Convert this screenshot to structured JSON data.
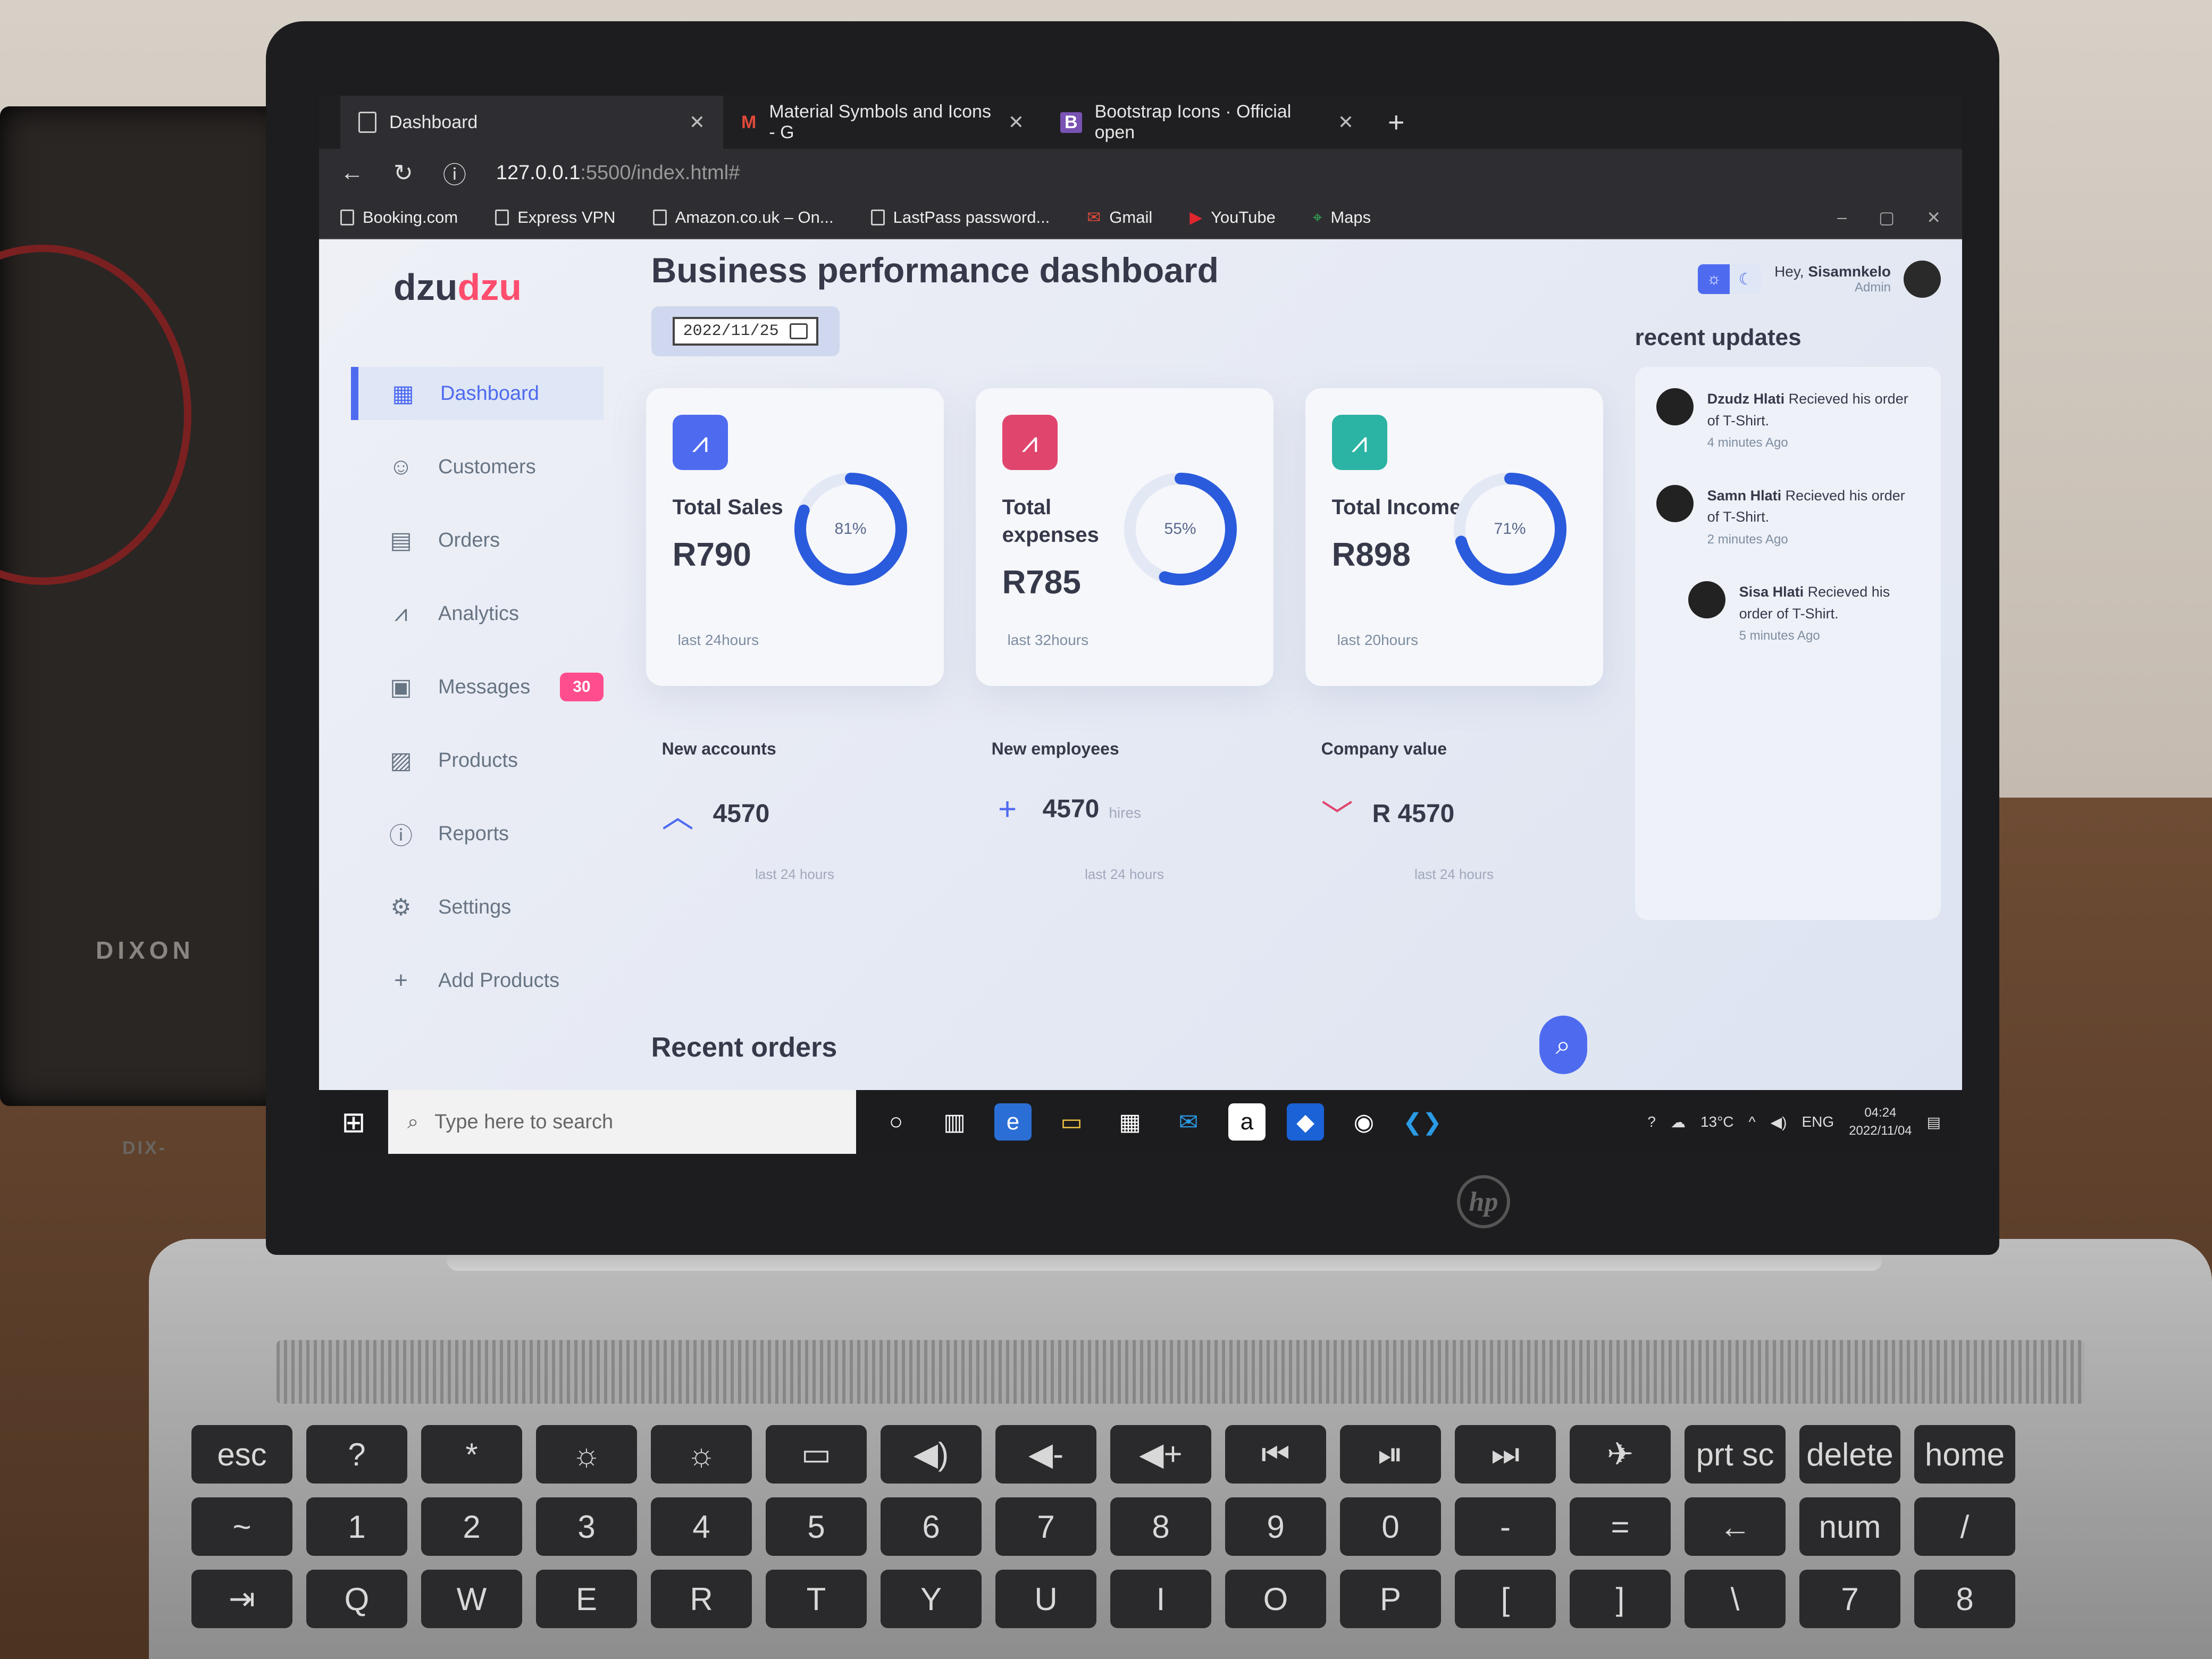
{
  "browser": {
    "tabs": [
      {
        "label": "Dashboard",
        "active": true
      },
      {
        "label": "Material Symbols and Icons - G",
        "active": false
      },
      {
        "label": "Bootstrap Icons · Official open",
        "active": false
      }
    ],
    "url_host": "127.0.0.1",
    "url_rest": ":5500/index.html#",
    "bookmarks": [
      "Booking.com",
      "Express VPN",
      "Amazon.co.uk – On...",
      "LastPass password...",
      "Gmail",
      "YouTube",
      "Maps"
    ]
  },
  "sidebar": {
    "brand_part1": "dzu",
    "brand_part2": "dzu",
    "items": [
      {
        "label": "Dashboard",
        "icon": "grid-icon",
        "active": true
      },
      {
        "label": "Customers",
        "icon": "person-icon"
      },
      {
        "label": "Orders",
        "icon": "receipt-icon"
      },
      {
        "label": "Analytics",
        "icon": "analytics-icon"
      },
      {
        "label": "Messages",
        "icon": "messages-icon",
        "badge": "30"
      },
      {
        "label": "Products",
        "icon": "clipboard-icon"
      },
      {
        "label": "Reports",
        "icon": "report-icon"
      },
      {
        "label": "Settings",
        "icon": "gear-icon"
      },
      {
        "label": "Add Products",
        "icon": "plus-icon"
      }
    ]
  },
  "main": {
    "title": "Business performance dashboard",
    "date": "2022/11/25",
    "cards": [
      {
        "title": "Total Sales",
        "value": "R790",
        "percent_label": "81%",
        "percent": 0.81,
        "sub": "last 24hours",
        "color": "#4e6bf0"
      },
      {
        "title": "Total expenses",
        "value": "R785",
        "percent_label": "55%",
        "percent": 0.55,
        "sub": "last 32hours",
        "color": "#e0456e"
      },
      {
        "title": "Total Income",
        "value": "R898",
        "percent_label": "71%",
        "percent": 0.71,
        "sub": "last 20hours",
        "color": "#2bb3a3"
      }
    ],
    "stats": [
      {
        "title": "New accounts",
        "value": "4570",
        "unit": "",
        "sub": "last 24 hours",
        "icon": "chevron-up-icon"
      },
      {
        "title": "New employees",
        "value": "4570",
        "unit": "hires",
        "sub": "last 24 hours",
        "icon": "plus-icon"
      },
      {
        "title": "Company value",
        "value": "R 4570",
        "unit": "",
        "sub": "last 24 hours",
        "icon": "chevron-down-icon"
      }
    ],
    "recent_orders": "Recent orders"
  },
  "right": {
    "greeting_prefix": "Hey,",
    "user": "Sisamnkelo",
    "role": "Admin",
    "recent_updates_title": "recent updates",
    "updates": [
      {
        "name": "Dzudz Hlati",
        "text": "Recieved his order of T-Shirt.",
        "time": "4 minutes Ago"
      },
      {
        "name": "Samn Hlati",
        "text": "Recieved his order of T-Shirt.",
        "time": "2 minutes Ago"
      },
      {
        "name": "Sisa Hlati",
        "text": "Recieved his order of T-Shirt.",
        "time": "5 minutes Ago"
      }
    ]
  },
  "taskbar": {
    "search_placeholder": "Type here to search",
    "weather": "13°C",
    "lang": "ENG",
    "time": "04:24",
    "date": "2022/11/04"
  },
  "hardware": {
    "speaker_brand": "DIXON",
    "speaker_brand2": "DIX-",
    "laptop_logo": "hp"
  }
}
